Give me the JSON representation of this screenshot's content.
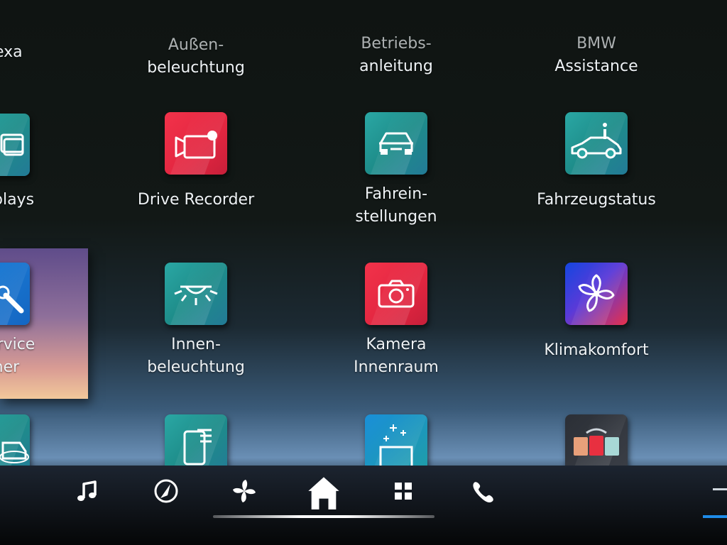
{
  "apps": {
    "row0": {
      "col0": "exa",
      "col1_line1": "Außen-",
      "col1_line2": "beleuchtung",
      "col2_line1": "Betriebs-",
      "col2_line2": "anleitung",
      "col3_line1": "BMW",
      "col3_line2": "Assistance"
    },
    "row1": {
      "col0": "plays",
      "col1": "Drive Recorder",
      "col2_line1": "Fahrein-",
      "col2_line2": "stellungen",
      "col3": "Fahrzeugstatus"
    },
    "row2": {
      "col0_line1": "ervice",
      "col0_line2": "tner",
      "col1_line1": "Innen-",
      "col1_line2": "beleuchtung",
      "col2_line1": "Kamera",
      "col2_line2": "Innenraum",
      "col3": "Klimakomfort"
    }
  },
  "icons": {
    "drive_recorder": "video-camera-record-icon",
    "fahreinstellungen": "car-front-icon",
    "fahrzeugstatus": "car-info-icon",
    "innenbeleuchtung": "ceiling-light-icon",
    "kamera_innenraum": "camera-icon",
    "klimakomfort": "fan-icon",
    "service": "wrench-icon",
    "displays": "displays-icon"
  },
  "taskbar": {
    "items": [
      "music-note-icon",
      "navigation-icon",
      "fan-icon",
      "home-icon",
      "apps-grid-icon",
      "phone-icon"
    ]
  },
  "colors": {
    "teal": "#2aa7a4",
    "red": "#e22640",
    "accent_blue": "#1e8be8"
  }
}
